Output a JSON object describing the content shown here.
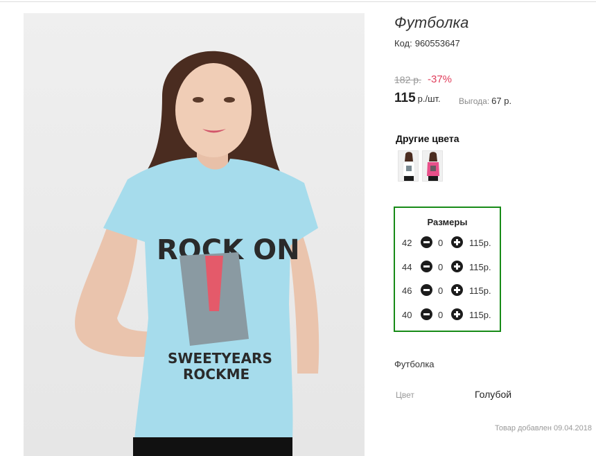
{
  "product": {
    "title": "Футболка",
    "code_label": "Код:",
    "code": "960553647",
    "image_alt": "ROCK ON"
  },
  "pricing": {
    "old_price": "182 р.",
    "discount": "-37%",
    "price": "115",
    "price_unit": "р./шт.",
    "saving_label": "Выгода:",
    "saving_value": "67 р."
  },
  "colors": {
    "heading": "Другие цвета",
    "swatches": [
      {
        "name": "white-tshirt",
        "color": "#ffffff"
      },
      {
        "name": "pink-tshirt",
        "color": "#e8508a"
      }
    ]
  },
  "sizes": {
    "heading": "Размеры",
    "rows": [
      {
        "size": "42",
        "qty": "0",
        "price": "115р."
      },
      {
        "size": "44",
        "qty": "0",
        "price": "115р."
      },
      {
        "size": "46",
        "qty": "0",
        "price": "115р."
      },
      {
        "size": "40",
        "qty": "0",
        "price": "115р."
      }
    ],
    "minus_icon": "minus-circle-icon",
    "plus_icon": "plus-circle-icon"
  },
  "description": {
    "title": "Футболка",
    "attributes": [
      {
        "label": "Цвет",
        "value": "Голубой"
      }
    ],
    "added_text": "Товар добавлен 09.04.2018"
  },
  "colors_theme": {
    "discount": "#e03c5a",
    "sizes_border": "#168a16",
    "tshirt": "#a6dcec"
  }
}
